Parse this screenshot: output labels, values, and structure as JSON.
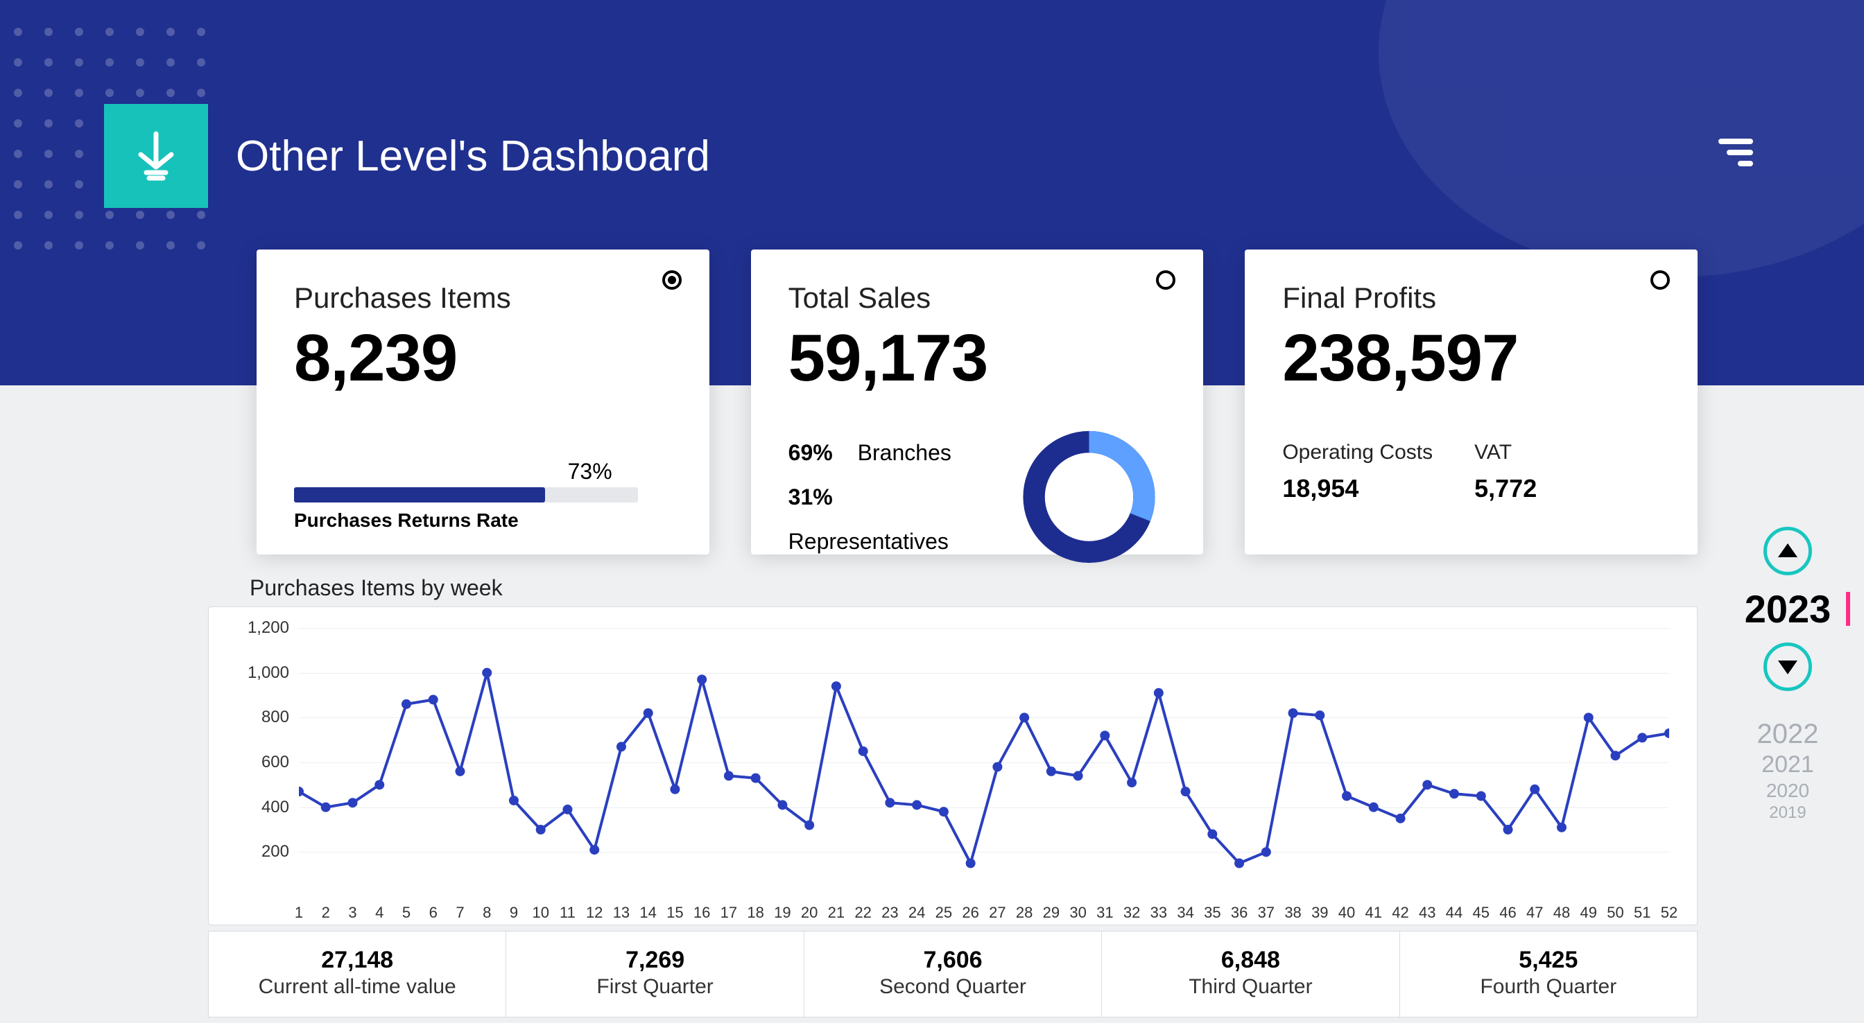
{
  "header": {
    "title": "Other Level's Dashboard"
  },
  "cards": {
    "purchases": {
      "title": "Purchases Items",
      "value": "8,239",
      "progress_pct": "73%",
      "progress_fill": 73,
      "progress_label": "Purchases Returns Rate",
      "selected": true
    },
    "sales": {
      "title": "Total Sales",
      "value": "59,173",
      "branches_pct": "69%",
      "branches_label": "Branches",
      "reps_pct": "31%",
      "reps_label": "Representatives",
      "selected": false
    },
    "profits": {
      "title": "Final Profits",
      "value": "238,597",
      "op_label": "Operating Costs",
      "op_value": "18,954",
      "vat_label": "VAT",
      "vat_value": "5,772",
      "selected": false
    }
  },
  "chart_data": {
    "type": "line",
    "title": "Purchases Items by week",
    "xlabel": "",
    "ylabel": "",
    "ylim": [
      0,
      1200
    ],
    "yticks": [
      200,
      400,
      600,
      800,
      1000,
      1200
    ],
    "x": [
      1,
      2,
      3,
      4,
      5,
      6,
      7,
      8,
      9,
      10,
      11,
      12,
      13,
      14,
      15,
      16,
      17,
      18,
      19,
      20,
      21,
      22,
      23,
      24,
      25,
      26,
      27,
      28,
      29,
      30,
      31,
      32,
      33,
      34,
      35,
      36,
      37,
      38,
      39,
      40,
      41,
      42,
      43,
      44,
      45,
      46,
      47,
      48,
      49,
      50,
      51,
      52
    ],
    "values": [
      470,
      400,
      420,
      500,
      860,
      880,
      560,
      1000,
      430,
      300,
      390,
      210,
      670,
      820,
      480,
      970,
      540,
      530,
      410,
      320,
      940,
      650,
      420,
      410,
      380,
      150,
      580,
      800,
      560,
      540,
      720,
      510,
      910,
      470,
      280,
      150,
      200,
      820,
      810,
      450,
      400,
      350,
      500,
      460,
      450,
      300,
      480,
      310,
      800,
      630,
      710,
      730
    ]
  },
  "summary": [
    {
      "value": "27,148",
      "label": "Current all-time value"
    },
    {
      "value": "7,269",
      "label": "First Quarter"
    },
    {
      "value": "7,606",
      "label": "Second Quarter"
    },
    {
      "value": "6,848",
      "label": "Third Quarter"
    },
    {
      "value": "5,425",
      "label": "Fourth Quarter"
    }
  ],
  "year_picker": {
    "current": "2023",
    "others": [
      "2022",
      "2021",
      "2020",
      "2019"
    ]
  },
  "colors": {
    "brand_blue": "#20308f",
    "teal": "#17c2bb",
    "donut_dark": "#1d2d8f",
    "donut_light": "#5da0ff"
  }
}
